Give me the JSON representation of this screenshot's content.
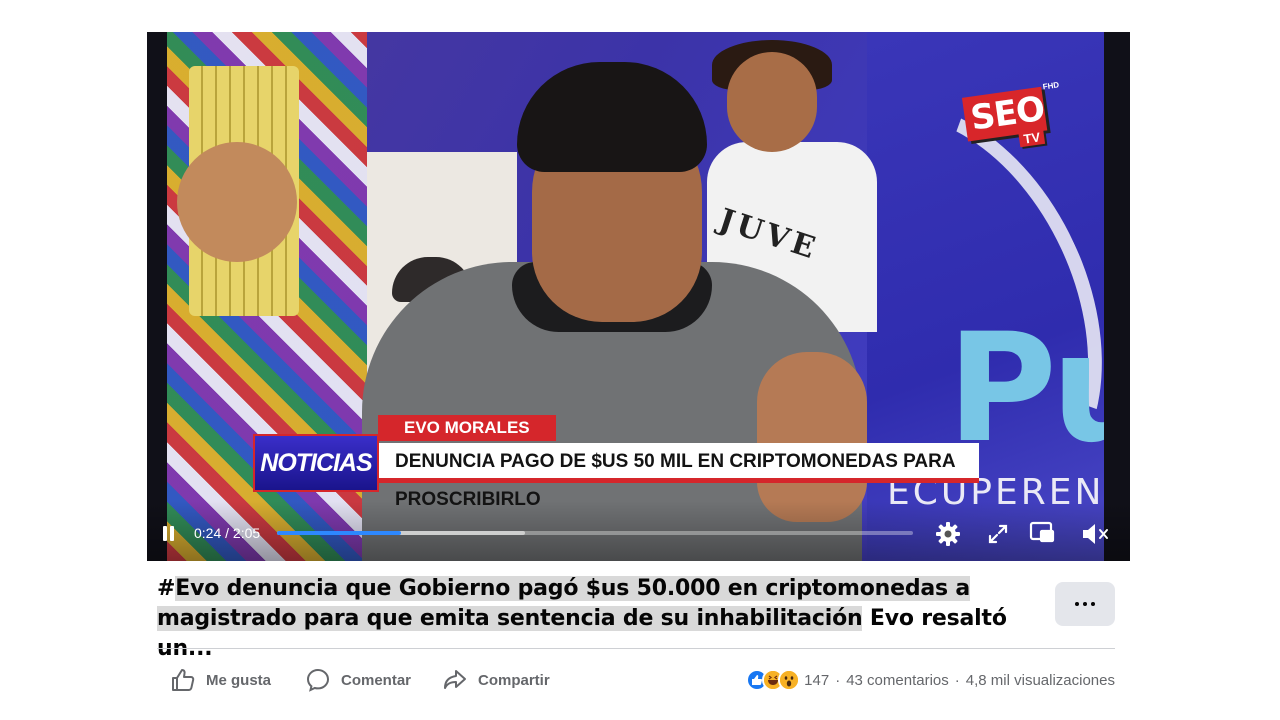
{
  "video": {
    "lower_third": {
      "name": "EVO MORALES",
      "tag": "NOTICIAS",
      "headline": "DENUNCIA PAGO DE $US 50 MIL EN CRIPTOMONEDAS PARA PROSCRIBIRLO"
    },
    "station_bug": {
      "main": "SEO",
      "sub": "TV",
      "quality": "FHD"
    },
    "background_text": {
      "juve": "JUVE",
      "big": "Pu",
      "recuperen": "ECUPEREN"
    },
    "controls": {
      "time": "0:24 / 2:05",
      "progress_fraction": 0.195,
      "buffer_fraction": 0.39,
      "pause_icon": "pause-icon",
      "settings_icon": "gear-icon",
      "fullscreen_icon": "expand-icon",
      "pip_icon": "picture-in-picture-icon",
      "volume_icon": "volume-muted-icon"
    }
  },
  "post": {
    "hashtag_text": "#",
    "highlighted_text": "Evo denuncia que Gobierno pagó $us 50.000 en criptomonedas a magistrado para que emita sentencia de su inhabilitación",
    "trailing_text": " Evo resaltó un...",
    "more_button_icon": "more-options-icon"
  },
  "actions": {
    "like": "Me gusta",
    "comment": "Comentar",
    "share": "Compartir"
  },
  "stats": {
    "reaction_count": "147",
    "comments": "43 comentarios",
    "views": "4,8 mil visualizaciones",
    "separator": "·"
  },
  "colors": {
    "accent": "#2d88ff",
    "facebook_blue": "#1877f2",
    "lower_third_red": "#d5262b",
    "muted_text": "#65676b"
  }
}
